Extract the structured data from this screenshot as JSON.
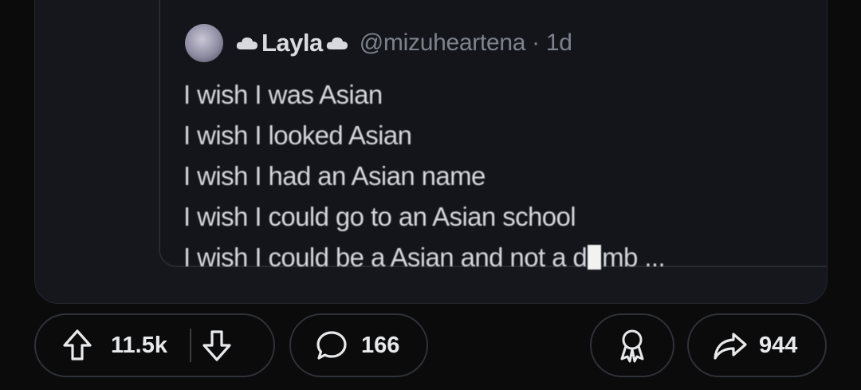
{
  "tweet": {
    "display_name": "Layla",
    "handle": "@mizuheartena",
    "separator": " · ",
    "time": "1d",
    "lines": [
      "I wish I was Asian",
      "I wish I looked Asian",
      "I wish I had an Asian name",
      "I wish I could go to an Asian school"
    ],
    "last_line_prefix": "I wish I could be a Asian and not a d",
    "last_line_suffix": "mb ..."
  },
  "actions": {
    "upvotes": "11.5k",
    "comments": "166",
    "shares": "944"
  },
  "icons": {
    "upvote": "arrow-up-outline-icon",
    "downvote": "arrow-down-outline-icon",
    "comment": "speech-bubble-icon",
    "award": "award-ribbon-icon",
    "share": "share-arrow-icon"
  }
}
